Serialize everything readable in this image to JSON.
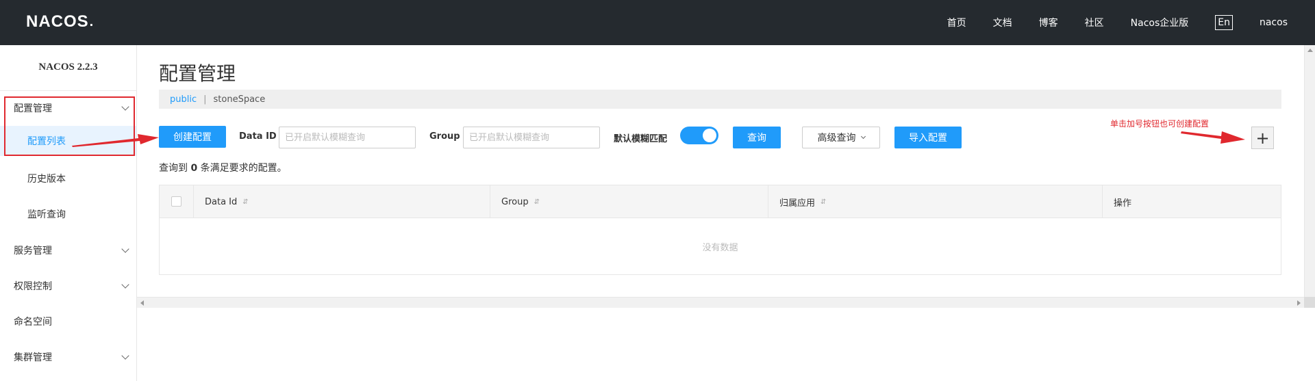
{
  "header": {
    "logo_text": "NACOS",
    "logo_dot": ".",
    "nav": [
      "首页",
      "文档",
      "博客",
      "社区",
      "Nacos企业版",
      "En",
      "nacos"
    ]
  },
  "sidebar": {
    "version": "NACOS 2.2.3",
    "config_group": "配置管理",
    "config_items": [
      "配置列表",
      "历史版本",
      "监听查询"
    ],
    "service_group": "服务管理",
    "auth_group": "权限控制",
    "namespace": "命名空间",
    "cluster_group": "集群管理"
  },
  "main": {
    "title": "配置管理",
    "namespaces": {
      "public": "public",
      "separator": "|",
      "other": "stoneSpace"
    },
    "toolbar": {
      "create_button": "创建配置",
      "dataid_label": "Data ID",
      "dataid_placeholder": "已开启默认模糊查询",
      "group_label": "Group",
      "group_placeholder": "已开启默认模糊查询",
      "fuzzy_label": "默认模糊匹配",
      "fuzzy_on": true,
      "query_button": "查询",
      "advanced_button": "高级查询",
      "import_button": "导入配置",
      "plus_button": "+"
    },
    "result": {
      "prefix": "查询到",
      "count": "0",
      "suffix": "条满足要求的配置。"
    },
    "table": {
      "columns": [
        "Data Id",
        "Group",
        "归属应用",
        "操作"
      ],
      "sort_glyph": "⇵",
      "empty_text": "没有数据"
    }
  },
  "annotation": {
    "hint_text": "单击加号按钮也可创建配置",
    "color": "#e0282e"
  },
  "colors": {
    "header_bg": "#252a2f",
    "primary": "#209bfa",
    "active_bg": "#e8f3fe"
  }
}
